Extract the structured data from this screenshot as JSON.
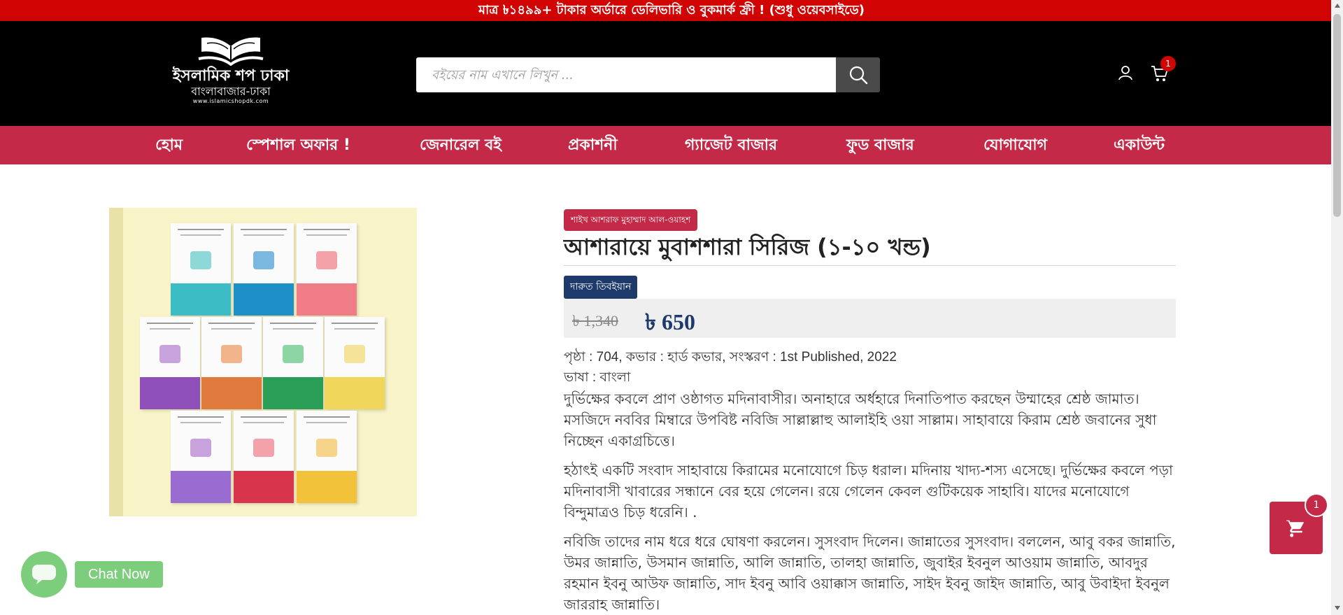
{
  "announcement": "মাত্র ৳১৪৯৯+ টাকার অর্ডারে ডেলিভারি ও বুকমার্ক ফ্রী ! (শুধু ওয়েবসাইডে)",
  "logo": {
    "title": "ইসলামিক শপ ঢাকা",
    "subtitle": "বাংলাবাজার-ঢাকা",
    "url": "www.islamicshopdk.com"
  },
  "search": {
    "placeholder": "বইয়ের নাম এখানে লিখুন ...",
    "value": ""
  },
  "header": {
    "cart_count": "1"
  },
  "nav": {
    "items": [
      {
        "label": "হোম"
      },
      {
        "label": "স্পেশাল অফার !"
      },
      {
        "label": "জেনারেল বই"
      },
      {
        "label": "প্রকাশনী"
      },
      {
        "label": "গ্যাজেট বাজার"
      },
      {
        "label": "ফুড বাজার"
      },
      {
        "label": "যোগাযোগ"
      },
      {
        "label": "একাউন্ট"
      }
    ]
  },
  "product": {
    "author": "শাইখ আশরাফ মুহাম্মাদ আল-ওয়াহশ",
    "title": "আশারায়ে মুবাশশারা সিরিজ (১-১০ খন্ড)",
    "publisher": "দারুত তিবইয়ান",
    "old_price": "৳ 1,340",
    "new_price": "৳ 650",
    "specs": "পৃষ্ঠা : 704, কভার : হার্ড কভার, সংস্করণ : 1st Published, 2022",
    "language": "ভাষা : বাংলা",
    "paragraph_1": "দুর্ভিক্ষের কবলে প্রাণ ওষ্ঠাগত মদিনাবাসীর। অনাহারে অর্ধহারে দিনাতিপাত করছেন উম্মাহের শ্রেষ্ঠ জামাত। মসজিদে নববির মিম্বারে উপবিষ্ট নবিজি সাল্লাল্লাহু আলাইহি ওয়া সাল্লাম। সাহাবায়ে কিরাম শ্রেষ্ঠ জবানের সুধা নিচ্ছেন একাগ্রচিত্তে।",
    "paragraph_2": "হঠাৎই একটি সংবাদ সাহাবায়ে কিরামের মনোযোগে চিড় ধরাল। মদিনায় খাদ্য-শস্য এসেছে। দুর্ভিক্ষের কবলে পড়া মদিনাবাসী খাবারের সন্ধানে বের হয়ে গেলেন। রয়ে গেলেন কেবল গুটিকয়েক সাহাবি। যাদের মনোযোগে বিন্দুমাত্রও চিড় ধরেনি। .",
    "paragraph_3": "নবিজি তাদের নাম ধরে ধরে ঘোষণা করলেন। সুসংবাদ দিলেন। জান্নাতের সুসংবাদ। বললেন, আবু বকর জান্নাতি, উমর জান্নাতি, উসমান জান্নাতি, আলি জান্নাতি, তালহা জান্নাতি, জুবাইর ইবনুল আওয়াম জান্নাতি, আবদুর রহমান ইবনু আউফ জান্নাতি, সাদ ইবনু আবি ওয়াক্কাস জান্নাতি, সাইদ ইবনু জাইদ জান্নাতি, আবু উবাইদা ইবনুল জাররাহ জান্নাতি।"
  },
  "floating_cart": {
    "count": "1"
  },
  "chat": {
    "label": "Chat Now"
  },
  "colors": {
    "announcement_bg": "#d10404",
    "header_bg": "#000000",
    "nav_bg": "#c42a47",
    "publisher_bg": "#1d3a6b",
    "price_color": "#1d3a6b",
    "chat_green": "#7ccd7c"
  },
  "icons": {
    "search": "search-icon",
    "user": "user-icon",
    "cart": "cart-icon",
    "floating_cart": "cart-icon",
    "chat": "chat-bubble-icon"
  }
}
